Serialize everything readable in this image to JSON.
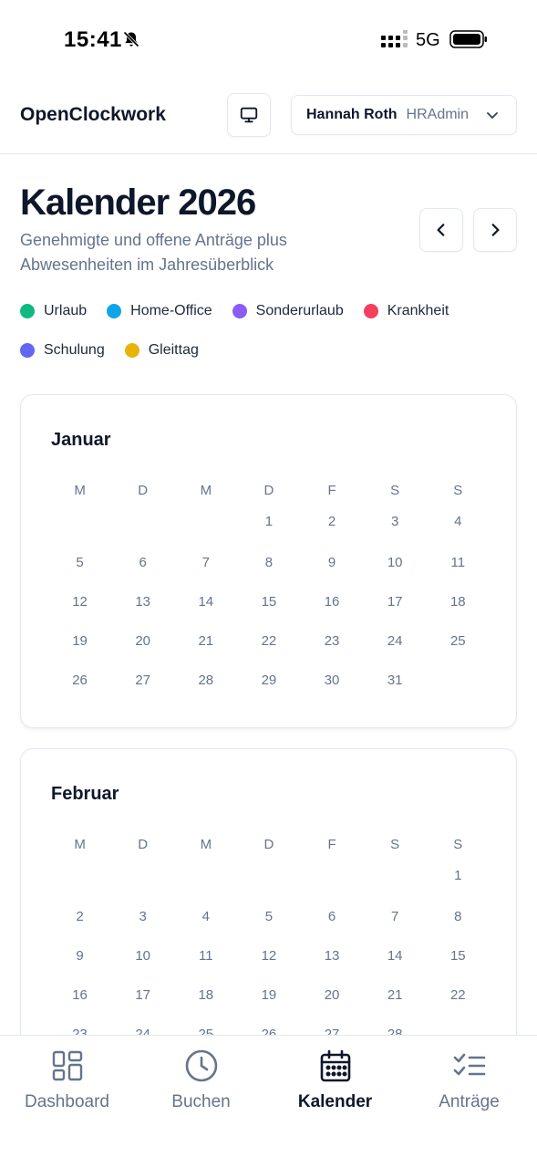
{
  "status_bar": {
    "time": "15:41",
    "network": "5G"
  },
  "header": {
    "brand": "OpenClockwork",
    "user_name": "Hannah Roth",
    "user_role": "HRAdmin"
  },
  "page": {
    "title": "Kalender 2026",
    "subtitle": "Genehmigte und offene Anträge plus Abwesenheiten im Jahresüberblick"
  },
  "legend": [
    {
      "label": "Urlaub",
      "color": "#10b981"
    },
    {
      "label": "Home-Office",
      "color": "#0ea5e9"
    },
    {
      "label": "Sonderurlaub",
      "color": "#8b5cf6"
    },
    {
      "label": "Krankheit",
      "color": "#f43f5e"
    },
    {
      "label": "Schulung",
      "color": "#6366f1"
    },
    {
      "label": "Gleittag",
      "color": "#eab308"
    }
  ],
  "weekdays": [
    "M",
    "D",
    "M",
    "D",
    "F",
    "S",
    "S"
  ],
  "months": [
    {
      "name": "Januar",
      "offset": 3,
      "days": 31
    },
    {
      "name": "Februar",
      "offset": 6,
      "days": 28
    }
  ],
  "bottom_nav": [
    {
      "label": "Dashboard",
      "icon": "dashboard-icon",
      "active": false
    },
    {
      "label": "Buchen",
      "icon": "clock-icon",
      "active": false
    },
    {
      "label": "Kalender",
      "icon": "calendar-icon",
      "active": true
    },
    {
      "label": "Anträge",
      "icon": "checklist-icon",
      "active": false
    }
  ],
  "colors": {
    "accent": "#0f172a",
    "muted": "#64748b",
    "border": "#e2e8f0"
  }
}
